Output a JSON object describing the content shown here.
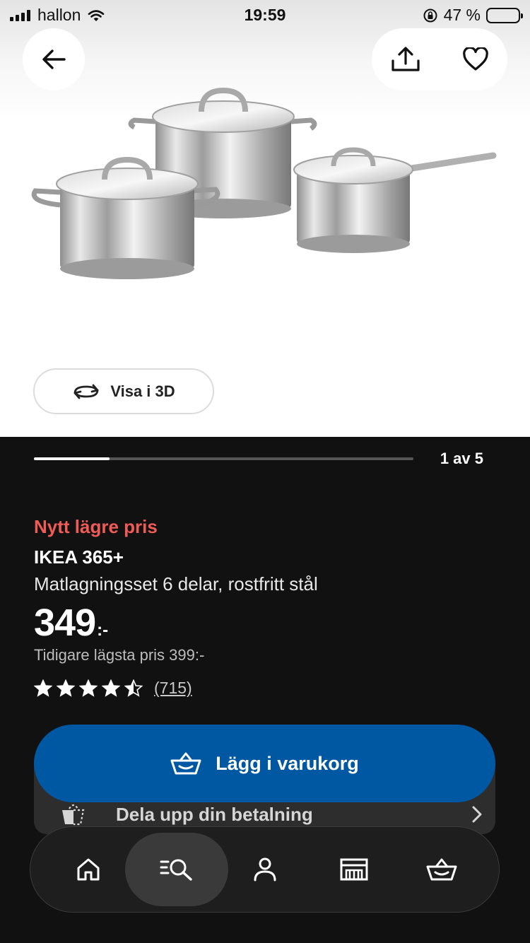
{
  "status_bar": {
    "carrier": "hallon",
    "time": "19:59",
    "battery": "47 %",
    "battery_level": 0.47
  },
  "gallery": {
    "current": 1,
    "total": 5,
    "pager_text": "1 av 5",
    "progress_fraction": 0.2
  },
  "view_3d_label": "Visa i 3D",
  "product": {
    "badge": "Nytt lägre pris",
    "brand": "IKEA 365+",
    "description": "Matlagningsset 6 delar, rostfritt stål",
    "price": "349",
    "price_suffix": ":-",
    "previous_price": "Tidigare lägsta pris 399:-",
    "rating": 4.5,
    "rating_max": 5,
    "review_count": "(715)"
  },
  "add_to_cart_label": "Lägg i varukorg",
  "split_payment_label": "Dela upp din betalning",
  "tabbar": {
    "items": [
      {
        "name": "home",
        "icon": "home-icon"
      },
      {
        "name": "search",
        "icon": "search-list-icon",
        "active": true
      },
      {
        "name": "profile",
        "icon": "person-icon"
      },
      {
        "name": "stores",
        "icon": "store-icon"
      },
      {
        "name": "cart",
        "icon": "basket-icon"
      }
    ]
  },
  "colors": {
    "accent": "#0058a3",
    "badge": "#ef5b56",
    "dark_bg": "#111111"
  }
}
